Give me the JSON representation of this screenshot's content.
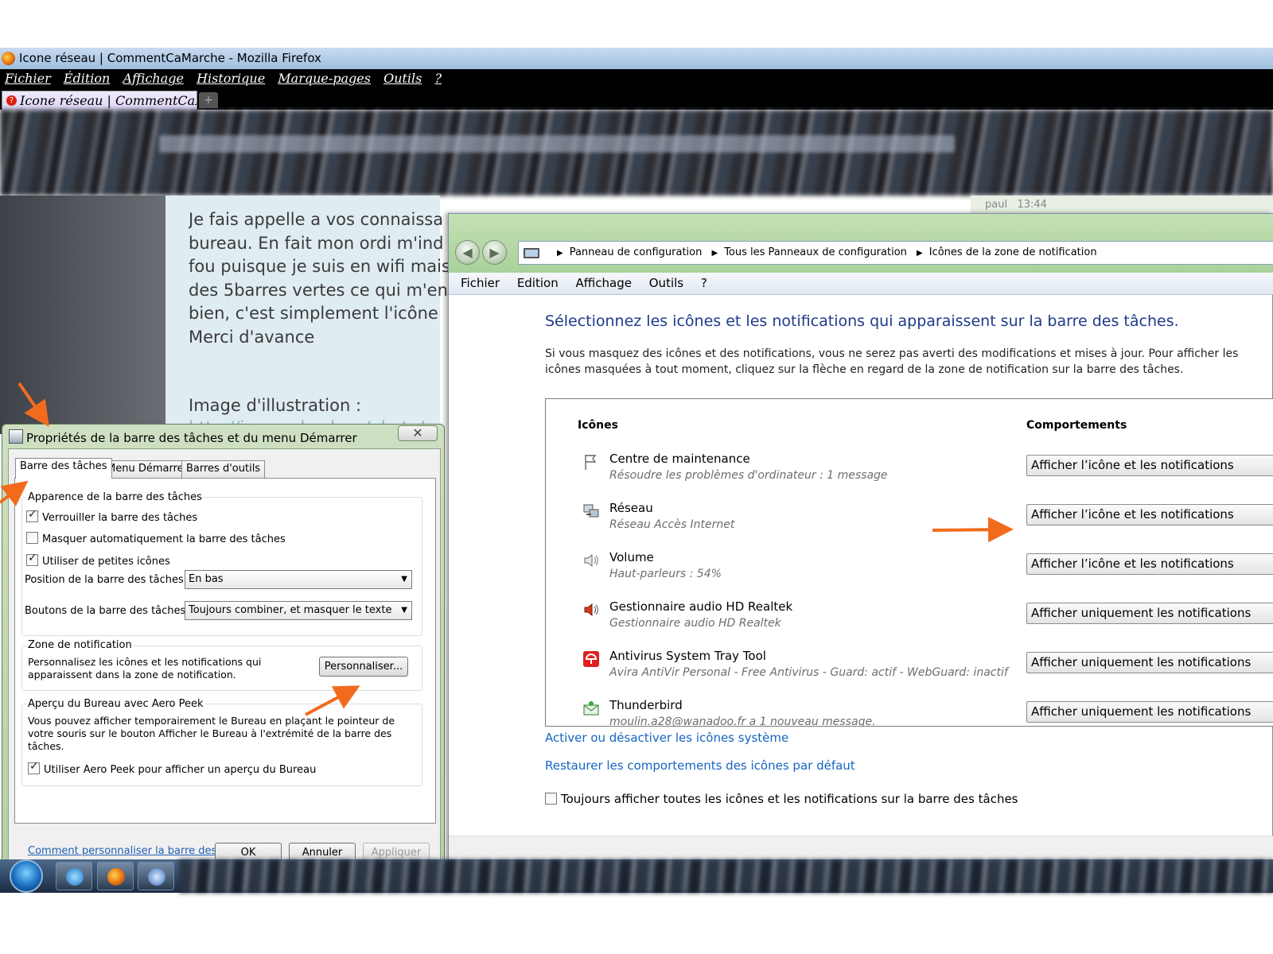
{
  "firefox": {
    "title": "Icone réseau | CommentCaMarche - Mozilla Firefox",
    "menu": [
      "Fichier",
      "Édition",
      "Affichage",
      "Historique",
      "Marque-pages",
      "Outils",
      "?"
    ],
    "tab_label": "Icone réseau | CommentCaM...",
    "new_tab": "+"
  },
  "forum": {
    "lines": [
      "Je fais appelle a vos connaissa",
      "bureau. En fait mon ordi m'ind",
      "fou puisque je suis en wifi mais",
      "des 5barres vertes ce qui m'en",
      "bien, c'est simplement l'icône",
      "Merci d'avance"
    ],
    "image_label": "Image d'illustration :",
    "image_link": "http://imageshack.us/photo/",
    "right_user": "paul",
    "right_time": "13:44"
  },
  "control_panel": {
    "breadcrumb": [
      "Panneau de configuration",
      "Tous les Panneaux de configuration",
      "Icônes de la zone de notification"
    ],
    "menu": [
      "Fichier",
      "Edition",
      "Affichage",
      "Outils",
      "?"
    ],
    "heading": "Sélectionnez les icônes et les notifications qui apparaissent sur la barre des tâches.",
    "description": "Si vous masquez des icônes et des notifications, vous ne serez pas averti des modifications et mises à jour. Pour afficher les icônes masquées à tout moment, cliquez sur la flèche en regard de la zone de notification sur la barre des tâches.",
    "col_icons": "Icônes",
    "col_behaviors": "Comportements",
    "rows": [
      {
        "name": "Centre de maintenance",
        "sub": "Résoudre les problèmes d'ordinateur : 1 message",
        "behavior": "Afficher l’icône et les notifications",
        "icon": "flag-icon"
      },
      {
        "name": "Réseau",
        "sub": "Réseau Accès Internet",
        "behavior": "Afficher l’icône et les notifications",
        "icon": "network-icon"
      },
      {
        "name": "Volume",
        "sub": "Haut-parleurs : 54%",
        "behavior": "Afficher l’icône et les notifications",
        "icon": "speaker-icon"
      },
      {
        "name": "Gestionnaire audio HD Realtek",
        "sub": "Gestionnaire audio HD Realtek",
        "behavior": "Afficher uniquement les notifications",
        "icon": "realtek-speaker-icon"
      },
      {
        "name": "Antivirus System Tray Tool",
        "sub": "Avira AntiVir Personal - Free Antivirus  - Guard: actif  - WebGuard: inactif",
        "behavior": "Afficher uniquement les notifications",
        "icon": "avira-umbrella-icon"
      },
      {
        "name": "Thunderbird",
        "sub": "moulin.a28@wanadoo.fr a 1 nouveau message.",
        "behavior": "Afficher uniquement les notifications",
        "icon": "mail-icon"
      }
    ],
    "link_system_icons": "Activer ou désactiver les icônes système",
    "link_restore": "Restaurer les comportements des icônes par défaut",
    "always_show_label": "Toujours afficher toutes les icônes et les notifications sur la barre des tâches",
    "always_show_checked": false
  },
  "dialog": {
    "title": "Propriétés de la barre des tâches et du menu Démarrer",
    "tabs": [
      "Barre des tâches",
      "Menu Démarrer",
      "Barres d'outils"
    ],
    "group_appearance": "Apparence de la barre des tâches",
    "opt_lock": "Verrouiller la barre des tâches",
    "opt_lock_checked": true,
    "opt_autohide": "Masquer automatiquement la barre des tâches",
    "opt_autohide_checked": false,
    "opt_small": "Utiliser de petites icônes",
    "opt_small_checked": true,
    "position_label": "Position de la barre des tâches :",
    "position_value": "En bas",
    "buttons_label": "Boutons de la barre des tâches :",
    "buttons_value": "Toujours combiner, et masquer le texte",
    "group_notif": "Zone de notification",
    "notif_text": "Personnalisez les icônes et les notifications qui apparaissent dans la zone de notification.",
    "customize_btn": "Personnaliser...",
    "group_peek": "Aperçu du Bureau avec Aero Peek",
    "peek_text": "Vous pouvez afficher temporairement le Bureau en plaçant le pointeur de votre souris sur le bouton Afficher le Bureau à l'extrémité de la barre des tâches.",
    "opt_peek": "Utiliser Aero Peek pour afficher un aperçu du Bureau",
    "opt_peek_checked": true,
    "help_link": "Comment personnaliser la barre des tâches ?",
    "ok": "OK",
    "cancel": "Annuler",
    "apply": "Appliquer"
  },
  "colors": {
    "annotation_arrow": "#f26b1d",
    "heading_blue": "#1e3a8a",
    "link_blue": "#1565c0"
  }
}
